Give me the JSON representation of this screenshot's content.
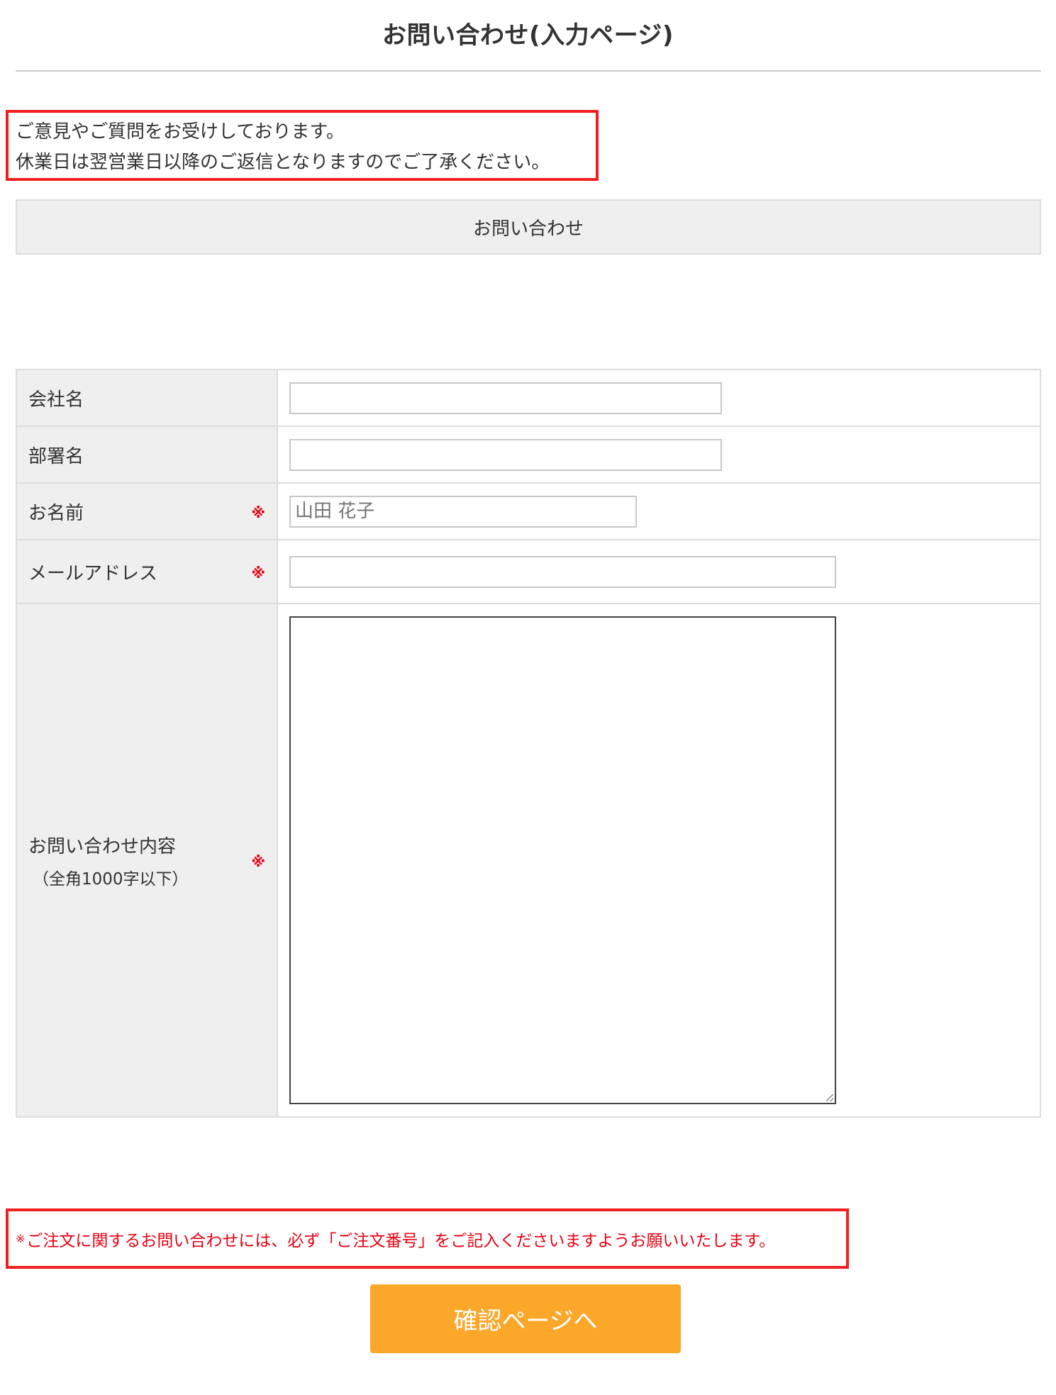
{
  "page": {
    "title": "お問い合わせ(入力ページ)"
  },
  "intro": {
    "line1": "ご意見やご質問をお受けしております。",
    "line2": "休業日は翌営業日以降のご返信となりますのでご了承ください。"
  },
  "section": {
    "heading": "お問い合わせ"
  },
  "form": {
    "required_mark": "※",
    "company": {
      "label": "会社名",
      "value": "",
      "placeholder": ""
    },
    "department": {
      "label": "部署名",
      "value": "",
      "placeholder": ""
    },
    "name": {
      "label": "お名前",
      "value": "",
      "placeholder": "山田 花子",
      "required": true
    },
    "email": {
      "label": "メールアドレス",
      "value": "",
      "placeholder": "",
      "required": true
    },
    "message": {
      "label": "お問い合わせ内容",
      "sublabel": "（全角1000字以下）",
      "value": "",
      "required": true
    }
  },
  "notice": {
    "mark": "※",
    "text": "ご注文に関するお問い合わせには、必ず「ご注文番号」をご記入くださいますようお願いいたします。"
  },
  "actions": {
    "confirm_label": "確認ページへ"
  },
  "colors": {
    "accent_button": "#fba72a",
    "highlight_border": "#f11f1f",
    "required_red": "#e60012",
    "label_bg": "#efefef"
  }
}
